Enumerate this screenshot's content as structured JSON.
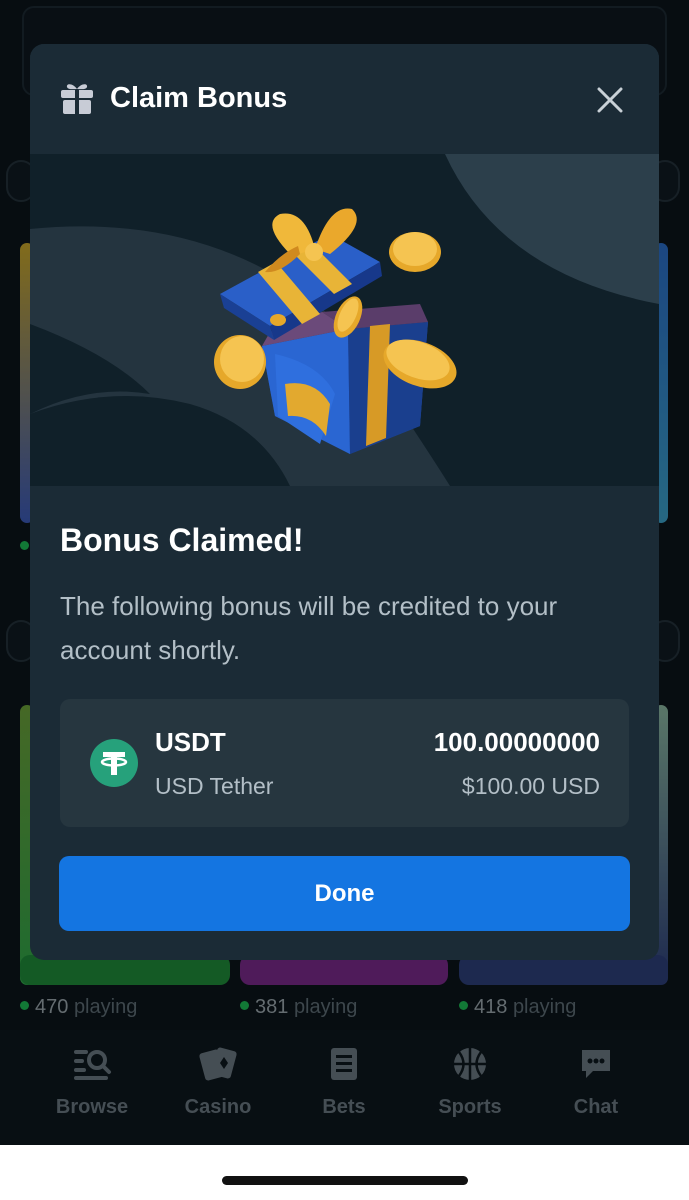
{
  "modal": {
    "title": "Claim Bonus",
    "heading": "Bonus Claimed!",
    "description": "The following bonus will be credited to your account shortly.",
    "bonus": {
      "symbol": "USDT",
      "name": "USD Tether",
      "amount": "100.00000000",
      "usd_value": "$100.00 USD"
    },
    "done_label": "Done"
  },
  "games": [
    {
      "count": "470",
      "suffix": "playing"
    },
    {
      "count": "381",
      "suffix": "playing"
    },
    {
      "count": "418",
      "suffix": "playing"
    }
  ],
  "bottom_nav": [
    {
      "label": "Browse",
      "icon": "browse-icon"
    },
    {
      "label": "Casino",
      "icon": "casino-cards-icon"
    },
    {
      "label": "Bets",
      "icon": "bets-slip-icon"
    },
    {
      "label": "Sports",
      "icon": "basketball-icon"
    },
    {
      "label": "Chat",
      "icon": "chat-bubble-icon"
    }
  ],
  "colors": {
    "accent": "#1475e1",
    "modal_bg": "#1b2b36",
    "card_bg": "#26363f",
    "tether_green": "#26a17b",
    "online_dot": "#1db954"
  }
}
